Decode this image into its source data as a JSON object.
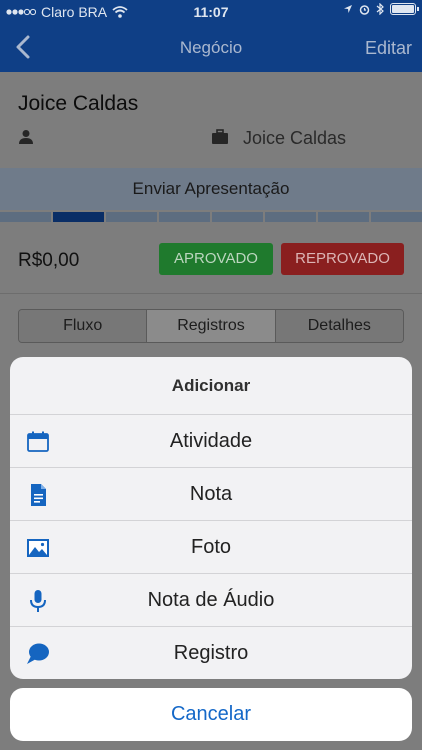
{
  "status": {
    "carrier": "Claro BRA",
    "time": "11:07"
  },
  "navbar": {
    "title": "Negócio",
    "edit_label": "Editar"
  },
  "deal": {
    "contact_name": "Joice Caldas",
    "company_name": "Joice Caldas",
    "stage": "Enviar Apresentação",
    "stage_count": 8,
    "stage_active_index": 1,
    "amount": "R$0,00",
    "approve_label": "APROVADO",
    "reject_label": "REPROVADO"
  },
  "tabs": [
    "Fluxo",
    "Registros",
    "Detalhes"
  ],
  "sheet": {
    "title": "Adicionar",
    "items": [
      {
        "icon": "calendar-icon",
        "label": "Atividade"
      },
      {
        "icon": "note-icon",
        "label": "Nota"
      },
      {
        "icon": "photo-icon",
        "label": "Foto"
      },
      {
        "icon": "microphone-icon",
        "label": "Nota de Áudio"
      },
      {
        "icon": "chat-icon",
        "label": "Registro"
      }
    ],
    "cancel_label": "Cancelar"
  },
  "colors": {
    "navbar": "#0f3f86",
    "icon_blue": "#1565c0",
    "cancel_blue": "#1468c8"
  }
}
